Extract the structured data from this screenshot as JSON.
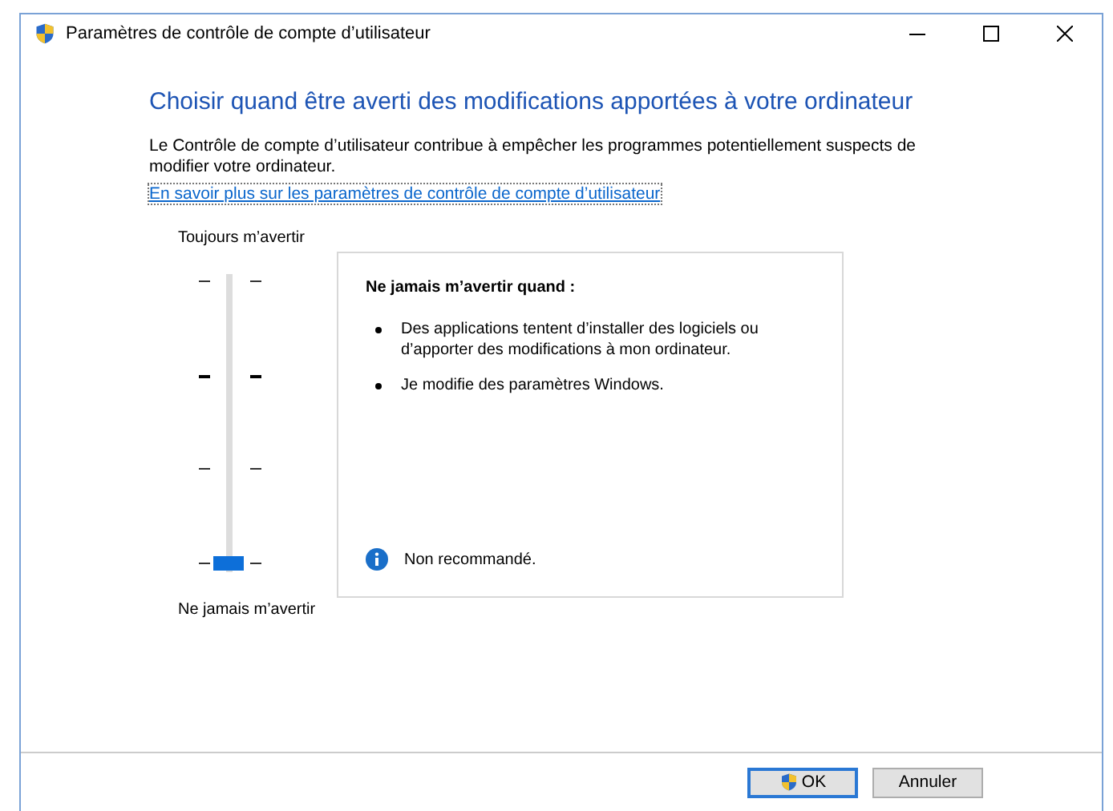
{
  "window": {
    "title": "Paramètres de contrôle de compte d’utilisateur"
  },
  "heading": "Choisir quand être averti des modifications apportées à votre ordinateur",
  "description": "Le Contrôle de compte d’utilisateur contribue à empêcher les programmes potentiellement suspects de modifier votre ordinateur.",
  "link": "En savoir plus sur les paramètres de contrôle de compte d’utilisateur",
  "slider": {
    "top_label": "Toujours m’avertir",
    "bottom_label": "Ne jamais m’avertir",
    "level": 0
  },
  "info_panel": {
    "title": "Ne jamais m’avertir quand :",
    "bullets": [
      "Des applications tentent d’installer des logiciels ou d’apporter des modifications à mon ordinateur.",
      "Je modifie des paramètres Windows."
    ],
    "note": "Non recommandé."
  },
  "buttons": [
    {
      "label": "OK",
      "kind": "primary"
    },
    {
      "label": "Annuler",
      "kind": "normal"
    }
  ]
}
